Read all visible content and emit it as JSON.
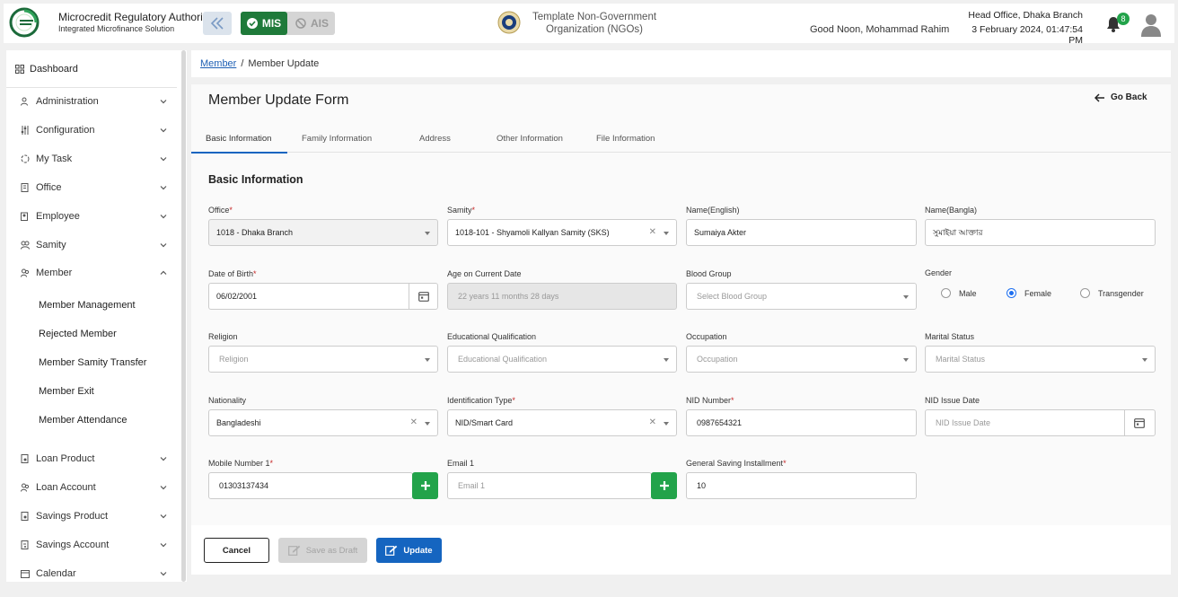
{
  "header": {
    "brand_title": "Microcredit Regulatory Authority",
    "brand_subtitle": "Integrated Microfinance Solution",
    "logo_text": "Microcredit Regulatory Authority",
    "modules": {
      "mis": "MIS",
      "ais": "AIS",
      "active": "MIS"
    },
    "org_name": "Template Non-Government Organization (NGOs)",
    "greeting": "Good Noon, Mohammad Rahim",
    "branch": "Head Office, Dhaka Branch",
    "datetime": "3 February 2024, 01:47:54 PM",
    "notification_count": "8"
  },
  "sidebar": {
    "dashboard": "Dashboard",
    "items": [
      {
        "label": "Administration",
        "icon": "users-gear-icon",
        "expanded": false
      },
      {
        "label": "Configuration",
        "icon": "sliders-icon",
        "expanded": false
      },
      {
        "label": "My Task",
        "icon": "task-cycle-icon",
        "expanded": false
      },
      {
        "label": "Office",
        "icon": "office-doc-icon",
        "expanded": false
      },
      {
        "label": "Employee",
        "icon": "employee-icon",
        "expanded": false
      },
      {
        "label": "Samity",
        "icon": "samity-icon",
        "expanded": false
      },
      {
        "label": "Member",
        "icon": "member-icon",
        "expanded": true
      },
      {
        "label": "Loan Product",
        "icon": "loan-product-icon",
        "expanded": false
      },
      {
        "label": "Loan Account",
        "icon": "loan-account-icon",
        "expanded": false
      },
      {
        "label": "Savings Product",
        "icon": "savings-product-icon",
        "expanded": false
      },
      {
        "label": "Savings Account",
        "icon": "savings-account-icon",
        "expanded": false
      },
      {
        "label": "Calendar",
        "icon": "calendar-icon",
        "expanded": false
      }
    ],
    "member_subitems": [
      "Member Management",
      "Rejected Member",
      "Member Samity Transfer",
      "Member Exit",
      "Member Attendance"
    ]
  },
  "breadcrumb": {
    "link": "Member",
    "current": "Member Update"
  },
  "form": {
    "title": "Member Update Form",
    "go_back": "Go Back",
    "tabs": [
      "Basic Information",
      "Family Information",
      "Address",
      "Other Information",
      "File Information"
    ],
    "active_tab": "Basic Information",
    "section_title": "Basic Information",
    "fields": {
      "office": {
        "label": "Office",
        "value": "1018 - Dhaka Branch"
      },
      "samity": {
        "label": "Samity",
        "value": "1018-101 - Shyamoli Kallyan Samity (SKS)"
      },
      "name_en": {
        "label": "Name(English)",
        "value": "Sumaiya Akter"
      },
      "name_bn": {
        "label": "Name(Bangla)",
        "value": "সুমাইয়া আক্তার"
      },
      "dob": {
        "label": "Date of Birth",
        "value": "06/02/2001"
      },
      "age": {
        "label": "Age on Current Date",
        "value": "22 years 11 months 28 days"
      },
      "blood_group": {
        "label": "Blood Group",
        "placeholder": "Select Blood Group"
      },
      "gender": {
        "label": "Gender",
        "options": [
          "Male",
          "Female",
          "Transgender"
        ],
        "selected": "Female"
      },
      "religion": {
        "label": "Religion",
        "placeholder": "Religion"
      },
      "education": {
        "label": "Educational Qualification",
        "placeholder": "Educational Qualification"
      },
      "occupation": {
        "label": "Occupation",
        "placeholder": "Occupation"
      },
      "marital": {
        "label": "Marital Status",
        "placeholder": "Marital Status"
      },
      "nationality": {
        "label": "Nationality",
        "value": "Bangladeshi"
      },
      "id_type": {
        "label": "Identification Type",
        "value": "NID/Smart Card"
      },
      "nid_number": {
        "label": "NID Number",
        "value": "0987654321"
      },
      "nid_issue": {
        "label": "NID Issue Date",
        "placeholder": "NID Issue Date"
      },
      "mobile": {
        "label": "Mobile Number 1",
        "value": "01303137434"
      },
      "email": {
        "label": "Email 1",
        "placeholder": "Email 1"
      },
      "saving": {
        "label": "General Saving Installment",
        "value": "10"
      }
    }
  },
  "actions": {
    "cancel": "Cancel",
    "draft": "Save as Draft",
    "update": "Update"
  },
  "colors": {
    "mis_green": "#1f7a3a",
    "primary_blue": "#1565c0",
    "add_green": "#22a34a",
    "required_red": "#c62828"
  }
}
